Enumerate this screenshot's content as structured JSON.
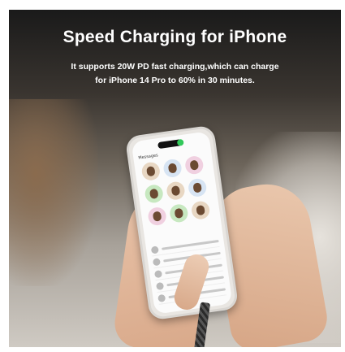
{
  "banner": {
    "title": "Speed Charging for iPhone",
    "subtitle_line1": "It supports 20W PD fast charging,which can charge",
    "subtitle_line2": "for iPhone 14 Pro to 60% in 30 minutes."
  },
  "phone_screen": {
    "app_title": "Messages"
  }
}
